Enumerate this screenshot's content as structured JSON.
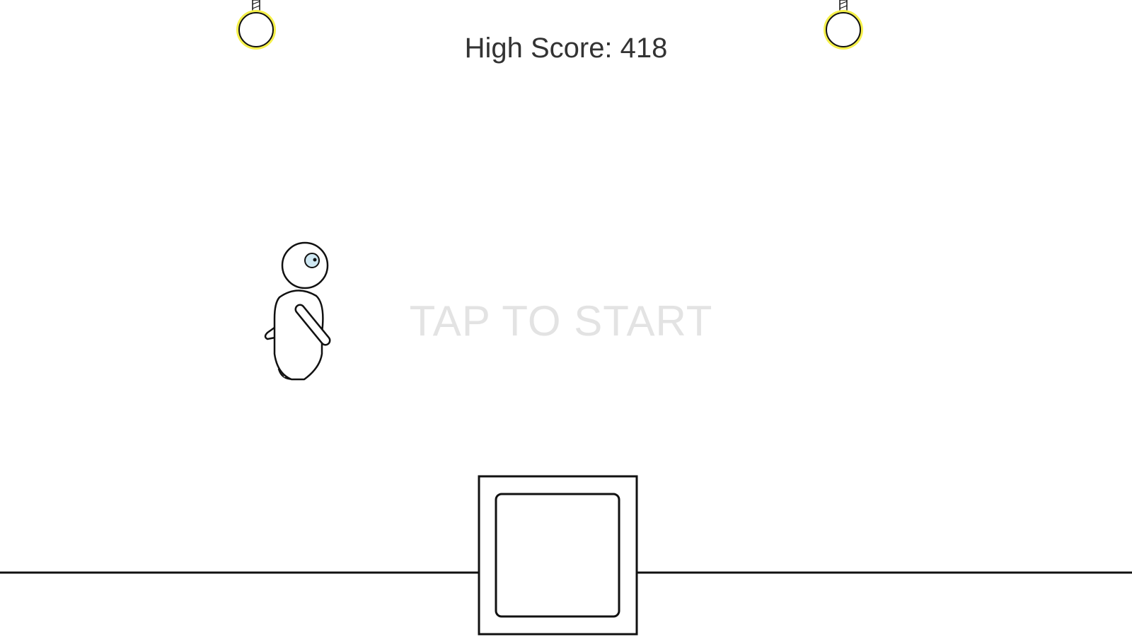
{
  "hud": {
    "high_score_label": "High Score:",
    "high_score_value": "418"
  },
  "overlay": {
    "start_prompt": "TAP TO START"
  },
  "icons": {
    "lamp": "hanging-light-bulb-icon",
    "player": "stick-figure-character",
    "obstacle": "square-box-obstacle"
  },
  "colors": {
    "background": "#ffffff",
    "text": "#333333",
    "prompt": "#e3e3e3",
    "lamp_glow": "#f5f04a",
    "eye": "#cfe8f3",
    "line": "#111111"
  }
}
